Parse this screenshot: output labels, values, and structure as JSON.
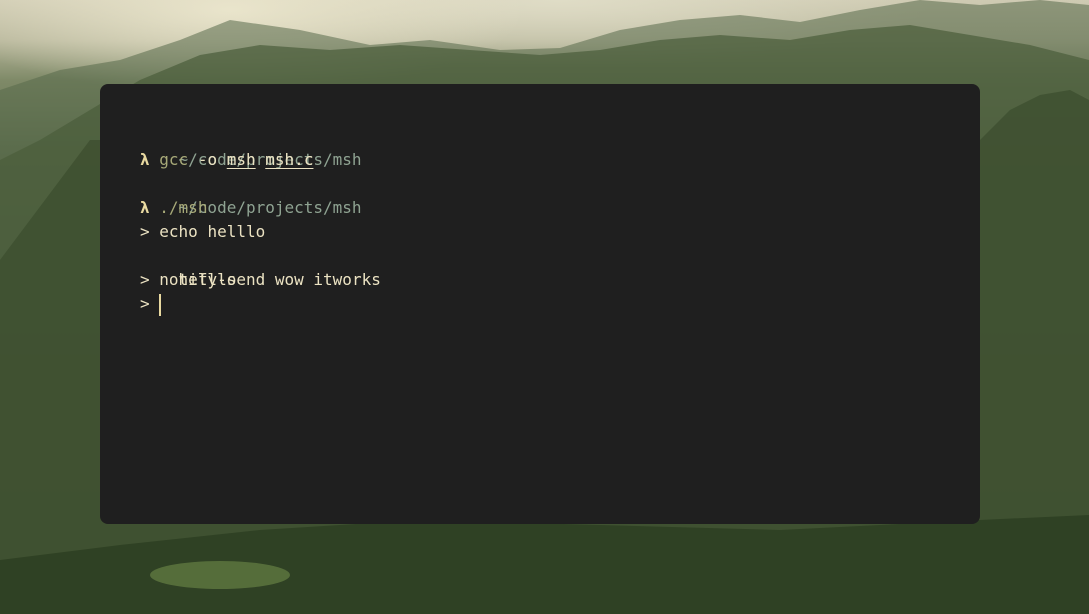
{
  "colors": {
    "terminal_bg": "#1f1f1f",
    "path": "#8fa392",
    "lambda": "#e8d9a0",
    "command": "#a7a978",
    "text": "#ebe2c2",
    "cursor": "#e8d9a0"
  },
  "terminal": {
    "lines": [
      {
        "type": "path",
        "text": "~/code/projects/msh"
      },
      {
        "type": "command",
        "lambda": "λ",
        "cmd": "gcc",
        "args": [
          "-o",
          "msh",
          "msh.c"
        ]
      },
      {
        "type": "path",
        "text": "~/code/projects/msh"
      },
      {
        "type": "command",
        "lambda": "λ",
        "cmd": "./msh"
      },
      {
        "type": "input",
        "prompt": ">",
        "text": "echo helllo"
      },
      {
        "type": "output",
        "text": "helllo"
      },
      {
        "type": "input",
        "prompt": ">",
        "text": "notify-send wow itworks"
      },
      {
        "type": "input",
        "prompt": ">",
        "text": ""
      }
    ]
  }
}
